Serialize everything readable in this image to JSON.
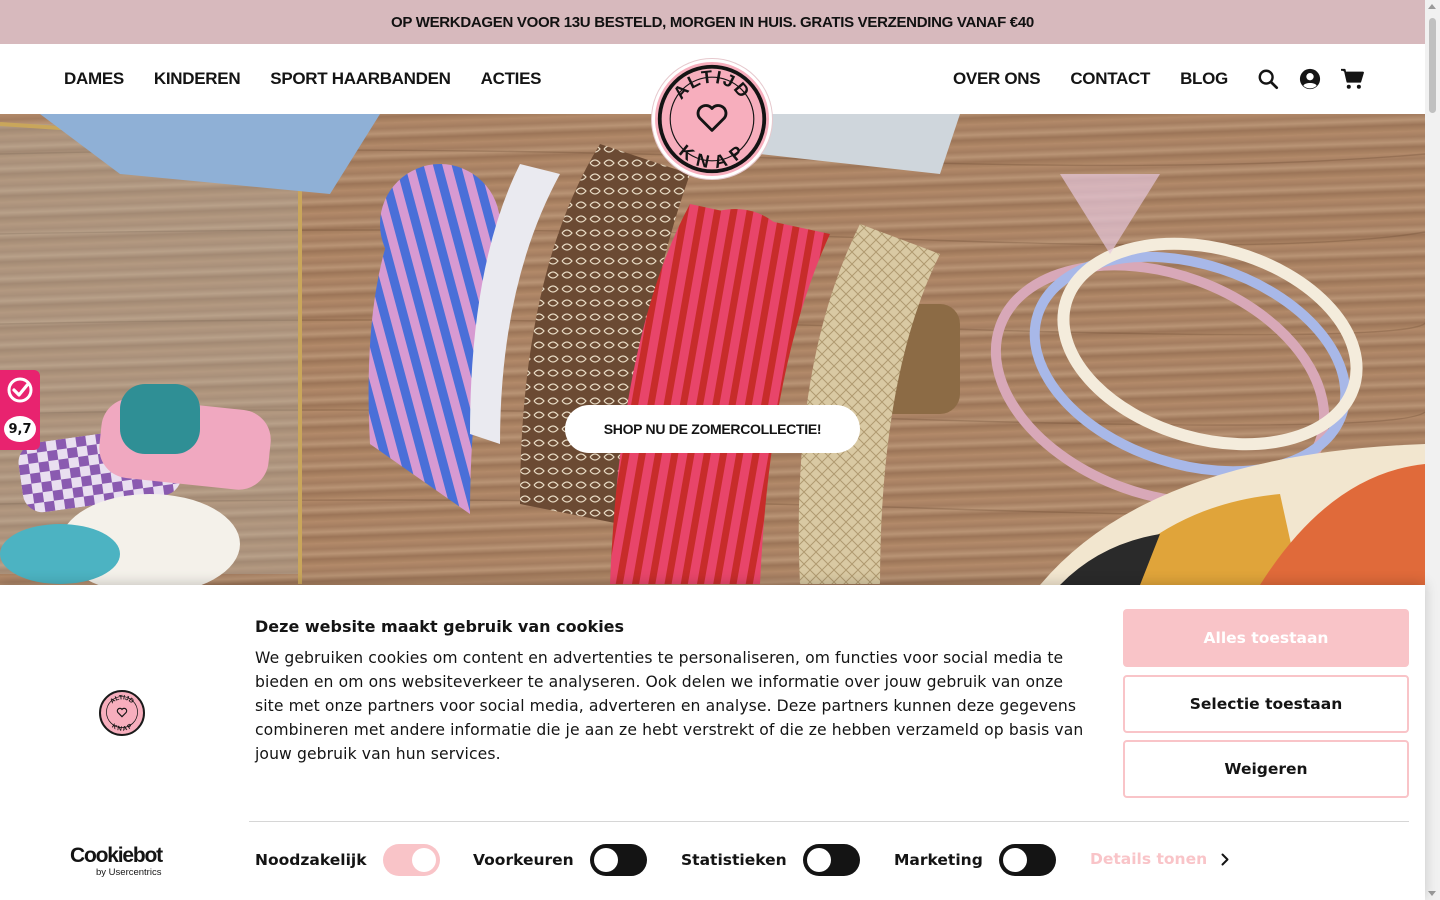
{
  "announcement": {
    "text": "OP WERKDAGEN VOOR 13U BESTELD, MORGEN IN HUIS. GRATIS VERZENDING VANAF €40"
  },
  "header": {
    "nav_left": [
      "DAMES",
      "KINDEREN",
      "SPORT HAARBANDEN",
      "ACTIES"
    ],
    "nav_right": [
      "OVER ONS",
      "CONTACT",
      "BLOG"
    ],
    "icons": [
      "search-icon",
      "account-icon",
      "cart-icon"
    ],
    "logo_text": "ALTIJD KNAP"
  },
  "hero": {
    "cta_label": "SHOP NU DE ZOMERCOLLECTIE!"
  },
  "rating_widget": {
    "score": "9,7",
    "color": "#e8236f"
  },
  "cookie_banner": {
    "title": "Deze website maakt gebruik van cookies",
    "body": "We gebruiken cookies om content en advertenties te personaliseren, om functies voor social media te bieden en om ons websiteverkeer te analyseren. Ook delen we informatie over jouw gebruik van onze site met onze partners voor social media, adverteren en analyse. Deze partners kunnen deze gegevens combineren met andere informatie die je aan ze hebt verstrekt of die ze hebben verzameld op basis van jouw gebruik van hun services.",
    "buttons": {
      "allow_all": "Alles toestaan",
      "allow_selection": "Selectie toestaan",
      "deny": "Weigeren"
    },
    "toggles": [
      {
        "label": "Noodzakelijk",
        "on": true
      },
      {
        "label": "Voorkeuren",
        "on": false
      },
      {
        "label": "Statistieken",
        "on": false
      },
      {
        "label": "Marketing",
        "on": false
      }
    ],
    "details_label": "Details tonen",
    "provider_name": "Cookiebot",
    "provider_sub": "by Usercentrics",
    "accent_color": "#f9c4c8"
  },
  "colors": {
    "announcement_bg": "#d7b9bd",
    "logo_pink": "#f7aebd"
  }
}
